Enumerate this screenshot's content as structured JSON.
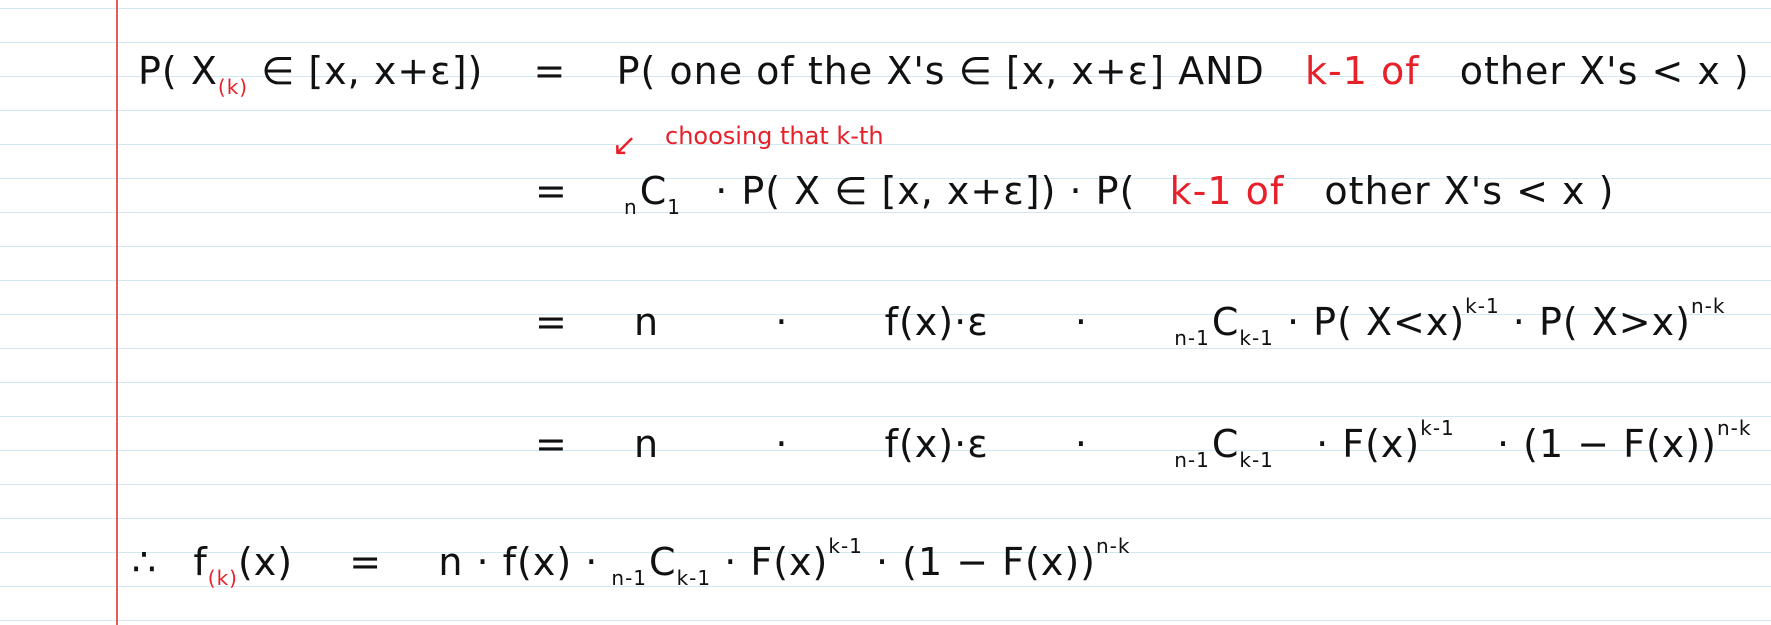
{
  "notebook": {
    "colors": {
      "ink": "#111111",
      "accent": "#e8202a",
      "rule": "#cfe8f3",
      "margin": "#e65a5a"
    }
  },
  "line1": {
    "lhs_P": "P(",
    "lhs_X": "X",
    "lhs_sub": "(k)",
    "lhs_rest": "∈ [x, x+ε])",
    "eq": "=",
    "rhs_a": "P( one of the X's ∈ [x, x+ε] AND",
    "rhs_red": "k-1 of",
    "rhs_b": "other X's < x )"
  },
  "annotation": {
    "arrow": "↙",
    "text": "choosing that k-th"
  },
  "line2": {
    "eq": "=",
    "pre_sub": "n",
    "C": "C",
    "sub": "1",
    "mid": "· P( X ∈ [x, x+ε]) · P(",
    "red": "k-1 of",
    "tail": "other X's < x )"
  },
  "line3": {
    "eq": "=",
    "n": "n",
    "dot1": "·",
    "f": "f(x)·ε",
    "dot2": "·",
    "pre_sub": "n-1",
    "C": "C",
    "sub": "k-1",
    "p1": "· P( X<x)",
    "sup1": "k-1",
    "p2": "· P( X>x)",
    "sup2": "n-k"
  },
  "line4": {
    "eq": "=",
    "n": "n",
    "dot1": "·",
    "f": "f(x)·ε",
    "dot2": "·",
    "pre_sub": "n-1",
    "C": "C",
    "sub": "k-1",
    "F": "· F(x)",
    "sup1": "k-1",
    "p2": "· (1 − F(x))",
    "sup2": "n-k"
  },
  "line5": {
    "therefore": "∴",
    "f": "f",
    "f_sub": "(k)",
    "fx": "(x)",
    "eq": "=",
    "n": "n · f(x) ·",
    "pre_sub": "n-1",
    "C": "C",
    "sub": "k-1",
    "F": "· F(x)",
    "sup1": "k-1",
    "p2": "· (1 − F(x))",
    "sup2": "n-k"
  }
}
